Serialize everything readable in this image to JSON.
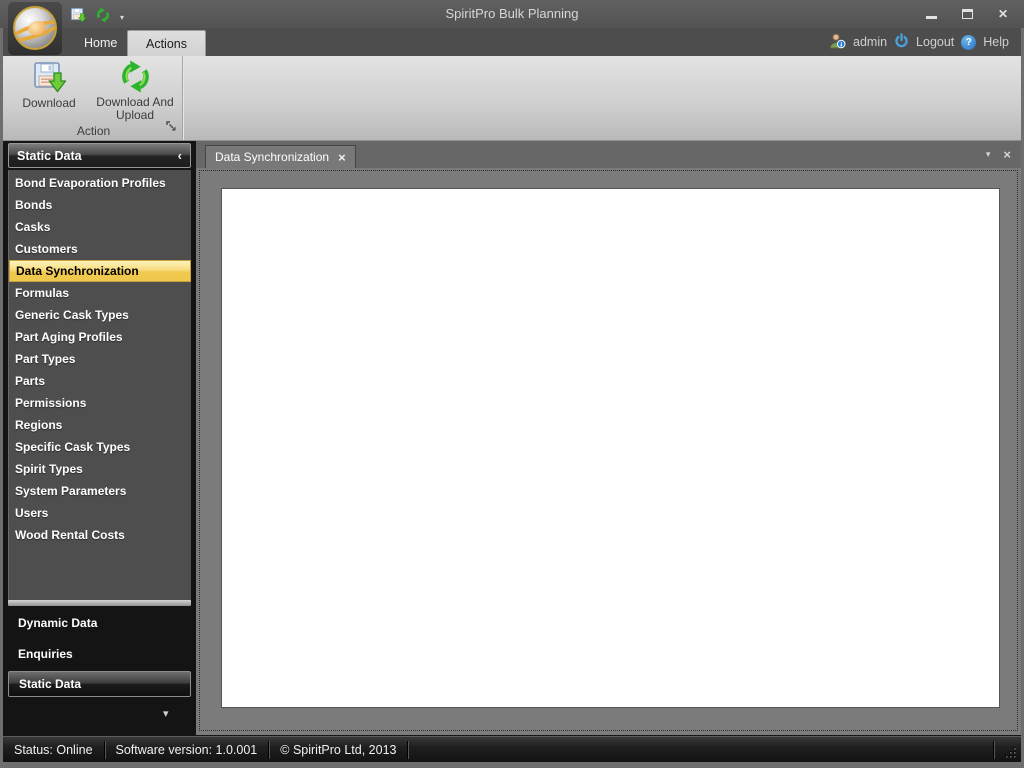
{
  "window": {
    "title": "SpiritPro Bulk Planning",
    "close_glyph": "✕"
  },
  "icons": {
    "qat_dropdown": "▾",
    "help_glyph": "?",
    "sidebar_collapse": "‹",
    "sidebar_overflow": "▾",
    "tab_close": "×",
    "docbar_dropdown": "▾",
    "docbar_close": "×"
  },
  "ribbon_tabs": [
    {
      "label": "Home"
    },
    {
      "label": "Actions"
    }
  ],
  "user_bar": {
    "username": "admin",
    "logout_label": "Logout",
    "help_label": "Help"
  },
  "ribbon": {
    "group_label": "Action",
    "buttons": [
      {
        "label": "Download"
      },
      {
        "label": "Download And Upload"
      }
    ]
  },
  "sidebar": {
    "header": "Static Data",
    "items": [
      "Bond Evaporation Profiles",
      "Bonds",
      "Casks",
      "Customers",
      "Data Synchronization",
      "Formulas",
      "Generic Cask Types",
      "Part Aging Profiles",
      "Part Types",
      "Parts",
      "Permissions",
      "Regions",
      "Specific Cask Types",
      "Spirit Types",
      "System Parameters",
      "Users",
      "Wood Rental Costs"
    ],
    "selected_item": "Data Synchronization",
    "sections": [
      "Dynamic Data",
      "Enquiries",
      "Static Data"
    ],
    "selected_section": "Static Data"
  },
  "document": {
    "tab_label": "Data Synchronization"
  },
  "status_bar": {
    "segments": [
      "Status: Online",
      "Software version: 1.0.001",
      "© SpiritPro Ltd, 2013"
    ]
  },
  "colors": {
    "selection_gold": "#F2C94E",
    "action_green": "#2DB32D",
    "accent_blue": "#4AA3E0",
    "titlebar_gray": "#585858",
    "sidebar_list_gray": "#4E4E4E",
    "content_gray": "#7B7B7B"
  }
}
